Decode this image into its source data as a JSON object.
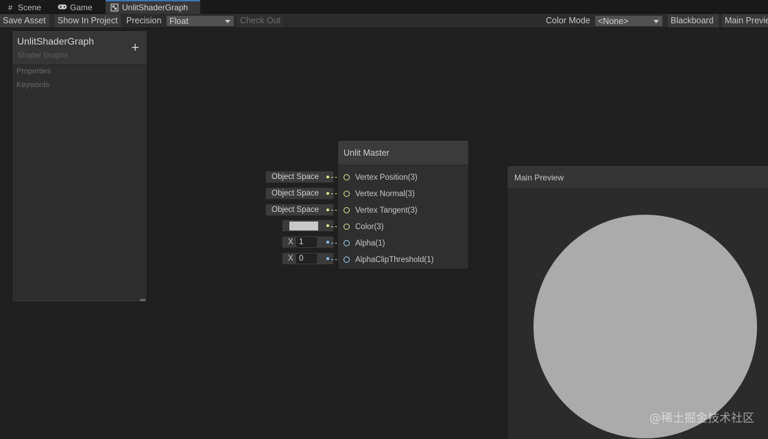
{
  "tabs": [
    {
      "label": "Scene",
      "icon": "grid-icon",
      "active": false
    },
    {
      "label": "Game",
      "icon": "gamepad-icon",
      "active": false
    },
    {
      "label": "UnlitShaderGraph",
      "icon": "shadergraph-icon",
      "active": true
    }
  ],
  "toolbar": {
    "save_asset": "Save Asset",
    "show_in_project": "Show In Project",
    "precision_label": "Precision",
    "precision_value": "Float",
    "check_out": "Check Out",
    "color_mode_label": "Color Mode",
    "color_mode_value": "<None>",
    "blackboard": "Blackboard",
    "main_preview": "Main Preview"
  },
  "blackboard": {
    "title": "UnlitShaderGraph",
    "subtitle": "Shader Graphs",
    "add_glyph": "+",
    "sections": [
      "Properties",
      "Keywords"
    ]
  },
  "master_node": {
    "title": "Unlit Master",
    "ports": [
      {
        "label": "Vertex Position(3)",
        "kind": "vector"
      },
      {
        "label": "Vertex Normal(3)",
        "kind": "vector"
      },
      {
        "label": "Vertex Tangent(3)",
        "kind": "vector"
      },
      {
        "label": "Color(3)",
        "kind": "vector"
      },
      {
        "label": "Alpha(1)",
        "kind": "float"
      },
      {
        "label": "AlphaClipThreshold(1)",
        "kind": "float"
      }
    ]
  },
  "inputs": {
    "vertex_position": "Object Space",
    "vertex_normal": "Object Space",
    "vertex_tangent": "Object Space",
    "color_swatch": "#c8c8c8",
    "alpha_axis": "X",
    "alpha_value": "1",
    "alpha_clip_axis": "X",
    "alpha_clip_value": "0"
  },
  "preview": {
    "title": "Main Preview",
    "sphere_color": "#ababab"
  },
  "watermark": "@稀土掘金技术社区",
  "colors": {
    "accent_tab": "#3a79bb",
    "vector_port": "#e8e89a",
    "float_port": "#9fd7ff",
    "canvas": "#202020"
  }
}
